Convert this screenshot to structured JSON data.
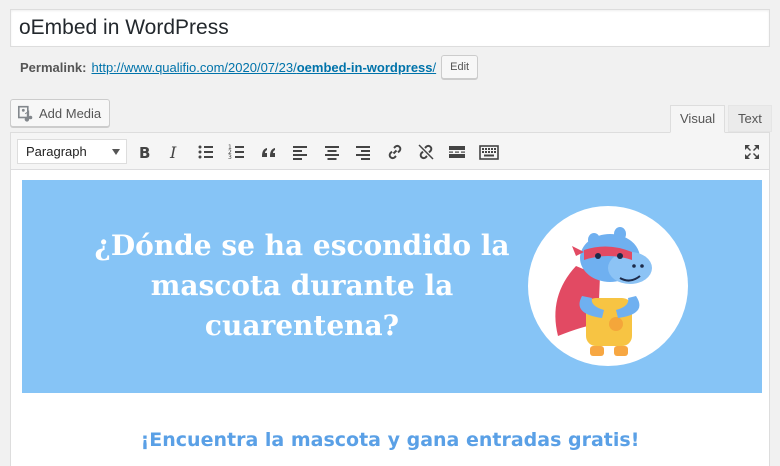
{
  "post": {
    "title": "oEmbed in WordPress",
    "permalink_label": "Permalink:",
    "permalink_base": "http://www.qualifio.com/2020/07/23/",
    "permalink_slug": "oembed-in-wordpress",
    "permalink_trailing": "/",
    "edit_label": "Edit"
  },
  "media": {
    "add_media_label": "Add Media"
  },
  "tabs": {
    "visual": "Visual",
    "text": "Text",
    "active": "Visual"
  },
  "toolbar": {
    "format_select": "Paragraph",
    "buttons": [
      "bold-icon",
      "italic-icon",
      "bullet-list-icon",
      "numbered-list-icon",
      "blockquote-icon",
      "align-left-icon",
      "align-center-icon",
      "align-right-icon",
      "link-icon",
      "unlink-icon",
      "read-more-icon",
      "toolbar-toggle-icon",
      "fullscreen-icon"
    ]
  },
  "content": {
    "banner_heading": "¿Dónde se ha escondido la mascota durante la cuarentena?",
    "banner_color": "#86c4f6",
    "cta_text": "¡Encuentra la mascota y gana entradas gratis!",
    "cta_color": "#5aa0e6"
  },
  "colors": {
    "link": "#0073aa",
    "page_bg": "#f1f1f1"
  }
}
